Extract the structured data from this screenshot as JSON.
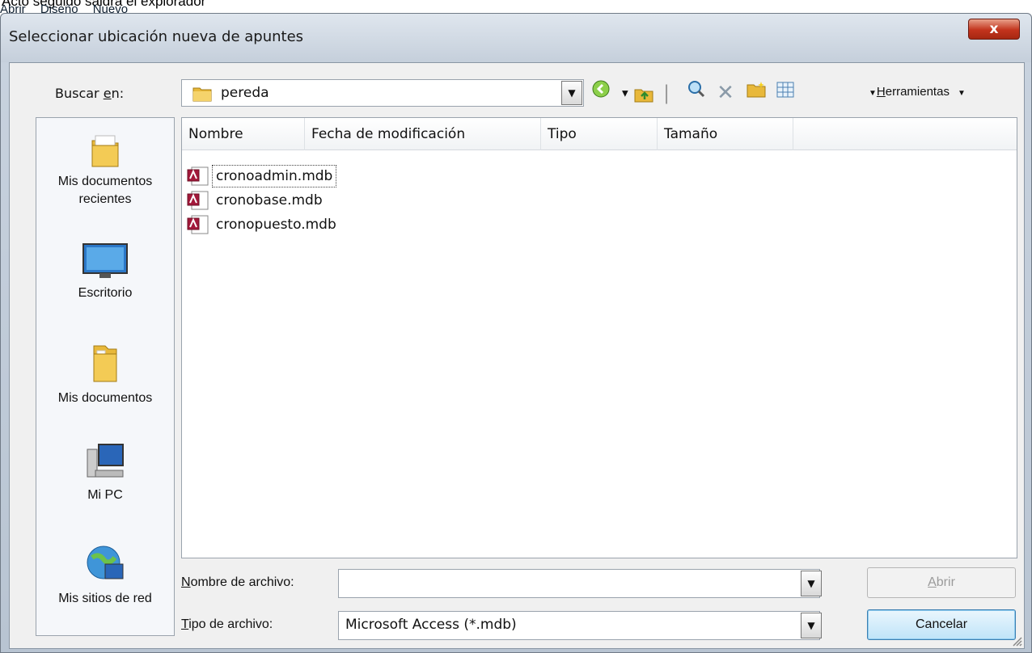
{
  "background": {
    "caption": "Acto seguido saldrá el explorador",
    "toolbar_items": [
      "Abrir",
      "Diseño",
      "Nuevo"
    ]
  },
  "dialog": {
    "title": "Seleccionar ubicación nueva de apuntes",
    "close_label": "x"
  },
  "lookin": {
    "label_pre": "Buscar ",
    "label_accel": "e",
    "label_post": "n:",
    "value": "pereda",
    "tools_accel": "H",
    "tools_rest": "erramientas"
  },
  "places": [
    {
      "label": "Mis documentos recientes",
      "icon": "recent-documents-icon"
    },
    {
      "label": "Escritorio",
      "icon": "desktop-icon"
    },
    {
      "label": "Mis documentos",
      "icon": "my-documents-icon"
    },
    {
      "label": "Mi PC",
      "icon": "my-computer-icon"
    },
    {
      "label": "Mis sitios de red",
      "icon": "network-places-icon"
    }
  ],
  "columns": [
    "Nombre",
    "Fecha de modificación",
    "Tipo",
    "Tamaño"
  ],
  "files": [
    {
      "name": "cronoadmin.mdb",
      "icon": "access-database-icon"
    },
    {
      "name": "cronobase.mdb",
      "icon": "access-database-icon"
    },
    {
      "name": "cronopuesto.mdb",
      "icon": "access-database-icon"
    }
  ],
  "filename": {
    "label_accel": "N",
    "label_rest": "ombre de archivo:",
    "value": ""
  },
  "filetype": {
    "label_accel": "T",
    "label_rest": "ipo de archivo:",
    "value": "Microsoft Access (*.mdb)"
  },
  "buttons": {
    "open_accel": "A",
    "open_rest": "brir",
    "cancel": "Cancelar"
  },
  "colors": {
    "title_bar": "#c5cfdb",
    "close_button": "#c2331c",
    "default_button": "#bfe4f8",
    "folder": "#e8b83a"
  }
}
